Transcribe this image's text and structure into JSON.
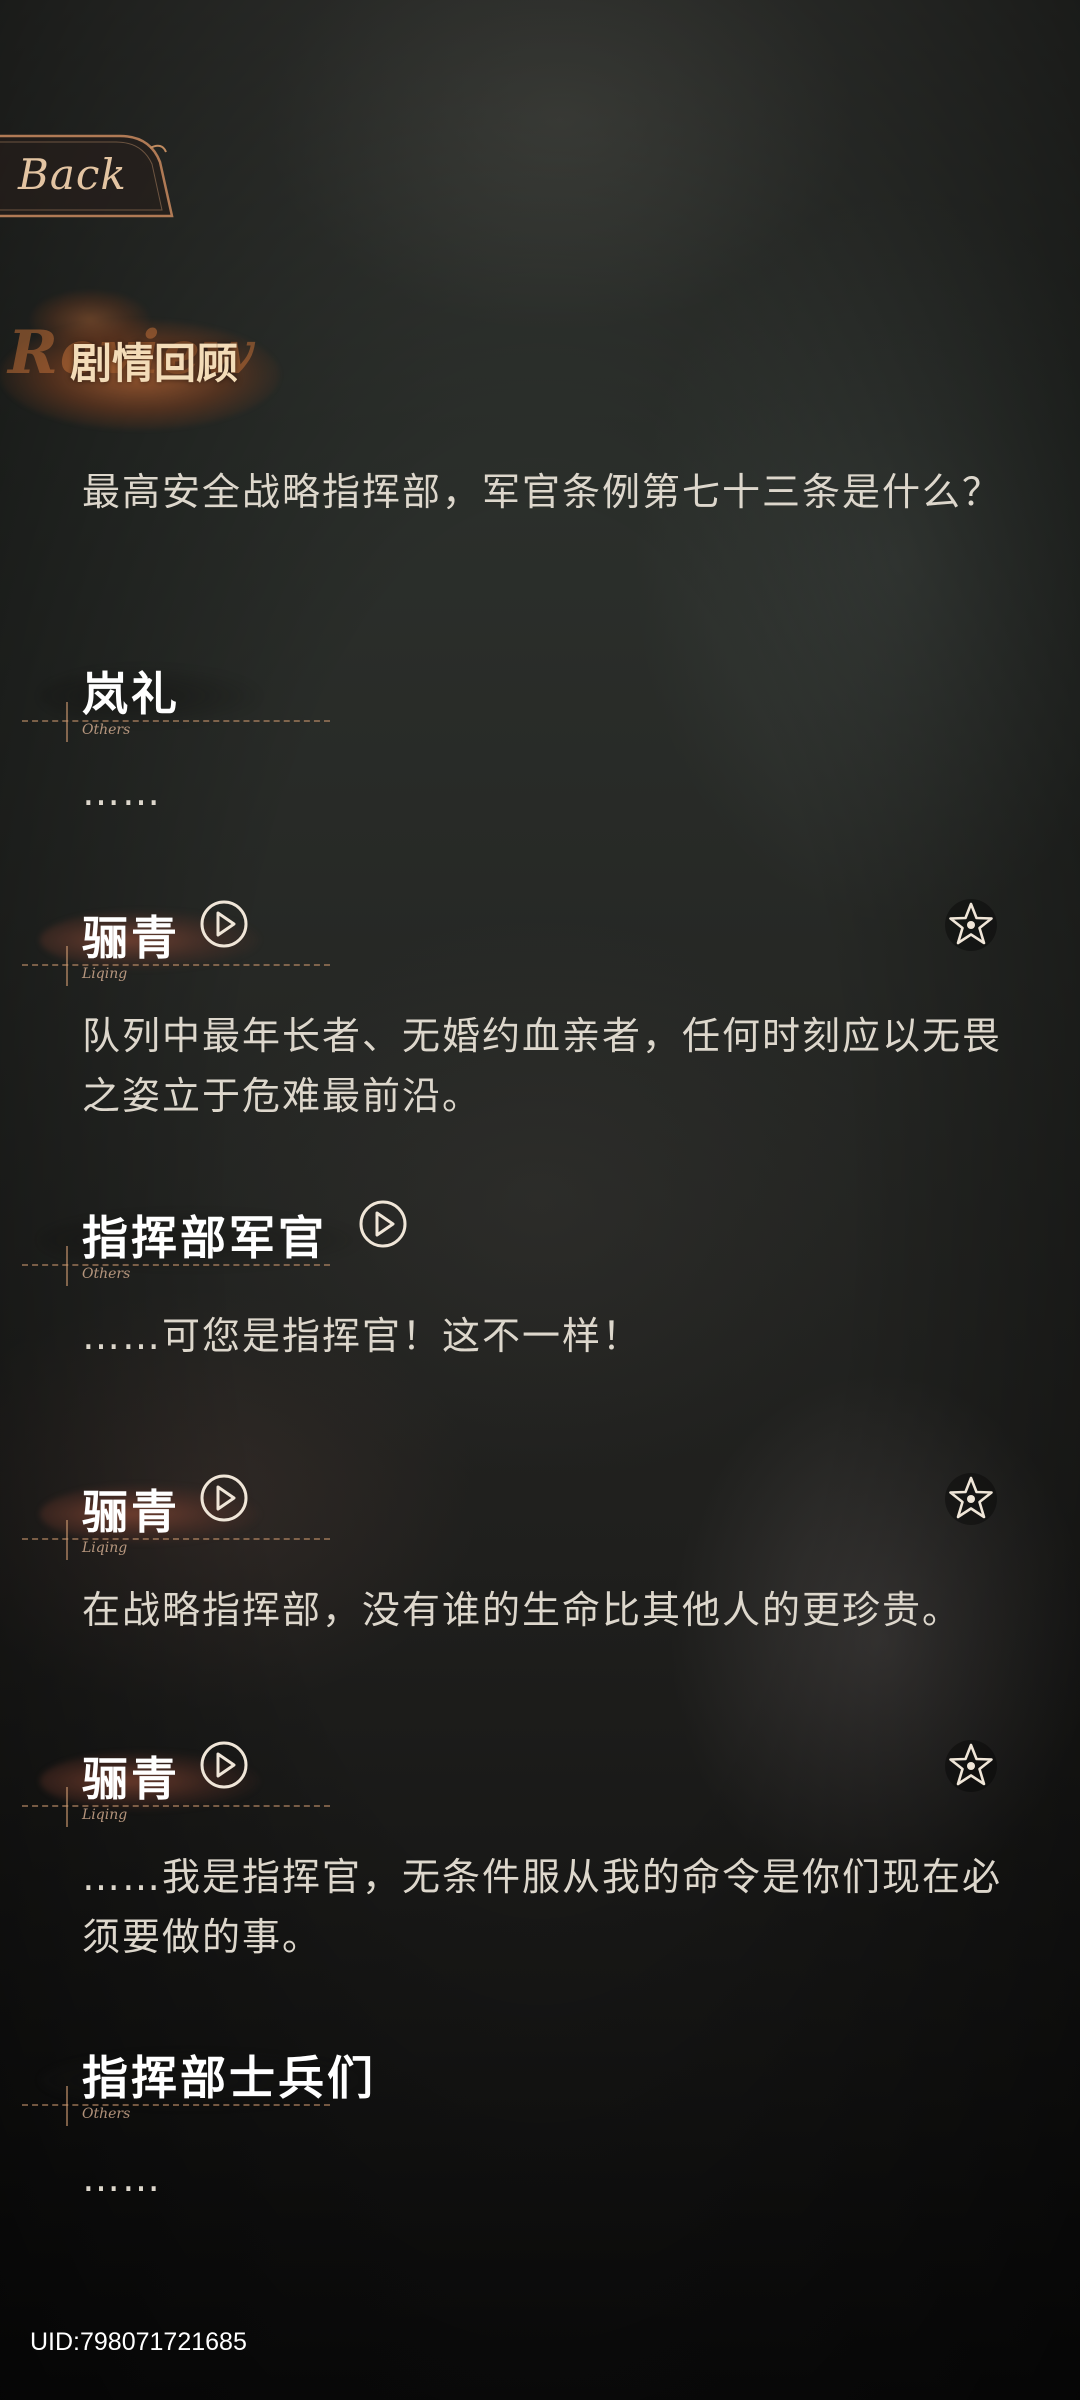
{
  "back_button": {
    "label": "Back"
  },
  "header": {
    "title": "剧情回顾",
    "title_decor": "Review"
  },
  "lines": [
    {
      "speaker": "",
      "speaker_sub": "",
      "text": "最高安全战略指挥部，军官条例第七十三条是什么？",
      "has_voice": false,
      "has_favorite": false
    },
    {
      "speaker": "岚礼",
      "speaker_sub": "Others",
      "text": "……",
      "has_voice": false,
      "has_favorite": false
    },
    {
      "speaker": "骊青",
      "speaker_sub": "Liqing",
      "text": "队列中最年长者、无婚约血亲者，任何时刻应以无畏之姿立于危难最前沿。",
      "has_voice": true,
      "has_favorite": true
    },
    {
      "speaker": "指挥部军官",
      "speaker_sub": "Others",
      "text": "……可您是指挥官！这不一样！",
      "has_voice": true,
      "has_favorite": false
    },
    {
      "speaker": "骊青",
      "speaker_sub": "Liqing",
      "text": "在战略指挥部，没有谁的生命比其他人的更珍贵。",
      "has_voice": true,
      "has_favorite": true
    },
    {
      "speaker": "骊青",
      "speaker_sub": "Liqing",
      "text": "……我是指挥官，无条件服从我的命令是你们现在必须要做的事。",
      "has_voice": true,
      "has_favorite": true
    },
    {
      "speaker": "指挥部士兵们",
      "speaker_sub": "Others",
      "text": "……",
      "has_voice": false,
      "has_favorite": false
    }
  ],
  "footer": {
    "uid": "UID:798071721685"
  },
  "icons": {
    "voice": "play-voice-icon",
    "favorite": "star-favorite-icon"
  },
  "colors": {
    "accent": "#c8956a",
    "title": "#f3dcb8",
    "text": "#ddd7cc"
  }
}
